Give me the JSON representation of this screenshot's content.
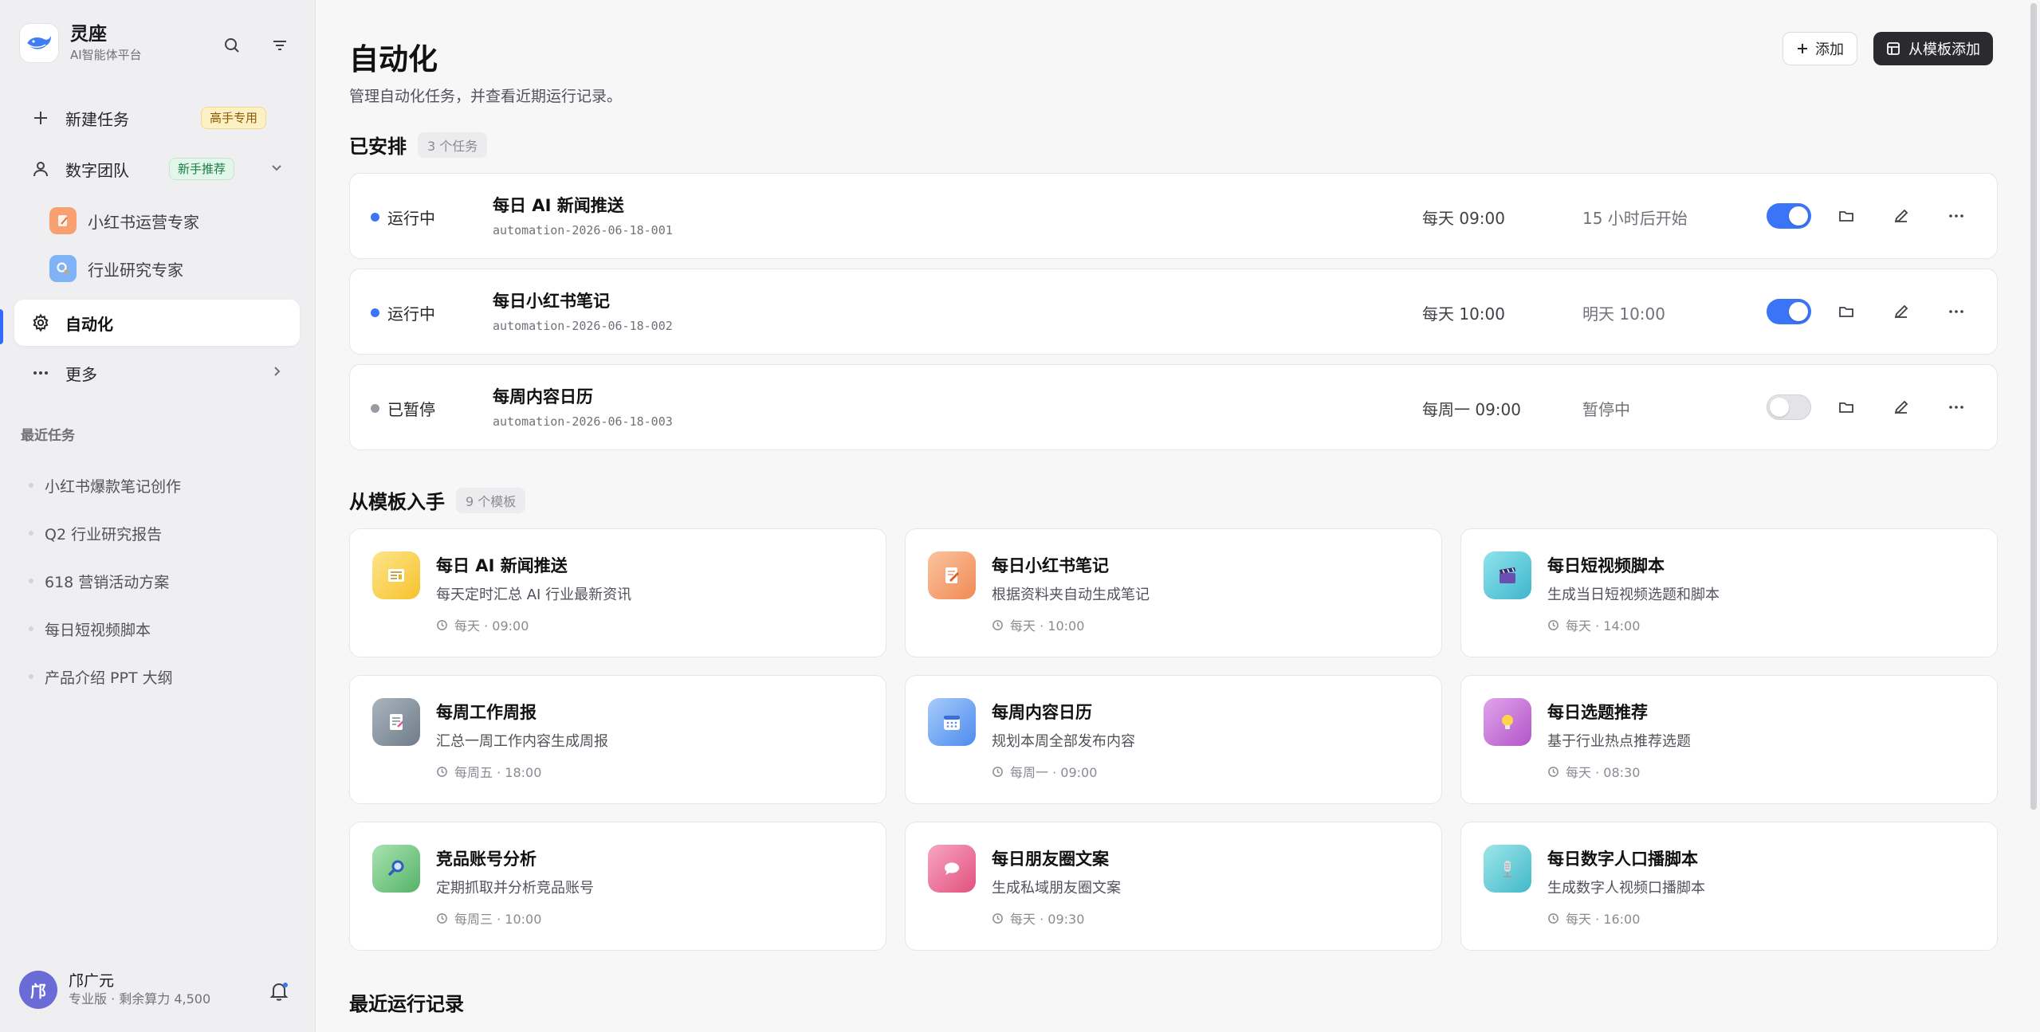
{
  "brand": {
    "name": "灵座",
    "subtitle": "AI智能体平台"
  },
  "sidebar": {
    "new_task": {
      "label": "新建任务",
      "badge": "高手专用"
    },
    "team": {
      "label": "数字团队",
      "badge": "新手推荐"
    },
    "experts": [
      {
        "label": "小红书运营专家"
      },
      {
        "label": "行业研究专家"
      }
    ],
    "automation": {
      "label": "自动化"
    },
    "more": {
      "label": "更多"
    },
    "recent_title": "最近任务",
    "recent": [
      "小红书爆款笔记创作",
      "Q2 行业研究报告",
      "618 营销活动方案",
      "每日短视频脚本",
      "产品介绍 PPT 大纲"
    ]
  },
  "user": {
    "initial": "邝",
    "name": "邝广元",
    "plan": "专业版 · 剩余算力 4,500"
  },
  "header": {
    "title": "自动化",
    "description": "管理自动化任务，并查看近期运行记录。",
    "add_label": "添加",
    "template_add_label": "从模板添加"
  },
  "scheduled": {
    "title": "已安排",
    "count": "3 个任务",
    "tasks": [
      {
        "status": "运行中",
        "name": "每日 AI 新闻推送",
        "id": "automation-2026-06-18-001",
        "schedule": "每天 09:00",
        "next": "15 小时后开始",
        "enabled": true
      },
      {
        "status": "运行中",
        "name": "每日小红书笔记",
        "id": "automation-2026-06-18-002",
        "schedule": "每天 10:00",
        "next": "明天 10:00",
        "enabled": true
      },
      {
        "status": "已暂停",
        "name": "每周内容日历",
        "id": "automation-2026-06-18-003",
        "schedule": "每周一 09:00",
        "next": "暂停中",
        "enabled": false
      }
    ]
  },
  "templates": {
    "title": "从模板入手",
    "count": "9 个模板",
    "items": [
      {
        "name": "每日 AI 新闻推送",
        "desc": "每天定时汇总 AI 行业最新资讯",
        "schedule": "每天 · 09:00",
        "icon": "newspaper-icon",
        "color": "#fbd34d"
      },
      {
        "name": "每日小红书笔记",
        "desc": "根据资料夹自动生成笔记",
        "schedule": "每天 · 10:00",
        "icon": "note-pen-icon",
        "color": "#f7a072"
      },
      {
        "name": "每日短视频脚本",
        "desc": "生成当日短视频选题和脚本",
        "schedule": "每天 · 14:00",
        "icon": "clapperboard-icon",
        "color": "#4fc8d8"
      },
      {
        "name": "每周工作周报",
        "desc": "汇总一周工作内容生成周报",
        "schedule": "每周五 · 18:00",
        "icon": "report-icon",
        "color": "#8b98a5"
      },
      {
        "name": "每周内容日历",
        "desc": "规划本周全部发布内容",
        "schedule": "每周一 · 09:00",
        "icon": "calendar-icon",
        "color": "#5b9cf0"
      },
      {
        "name": "每日选题推荐",
        "desc": "基于行业热点推荐选题",
        "schedule": "每天 · 08:30",
        "icon": "lightbulb-icon",
        "color": "#c86fd6"
      },
      {
        "name": "竞品账号分析",
        "desc": "定期抓取并分析竞品账号",
        "schedule": "每周三 · 10:00",
        "icon": "magnifier-icon",
        "color": "#6cc27a"
      },
      {
        "name": "每日朋友圈文案",
        "desc": "生成私域朋友圈文案",
        "schedule": "每天 · 09:30",
        "icon": "chat-bubble-icon",
        "color": "#ef6f9a"
      },
      {
        "name": "每日数字人口播脚本",
        "desc": "生成数字人视频口播脚本",
        "schedule": "每天 · 16:00",
        "icon": "microphone-icon",
        "color": "#56c9d3"
      }
    ]
  },
  "recent_runs": {
    "title": "最近运行记录"
  },
  "colors": {
    "accent": "#3b74f6",
    "running": "#3b74f6",
    "paused": "#9a9aa2",
    "dark_button": "#2b2b2f"
  }
}
